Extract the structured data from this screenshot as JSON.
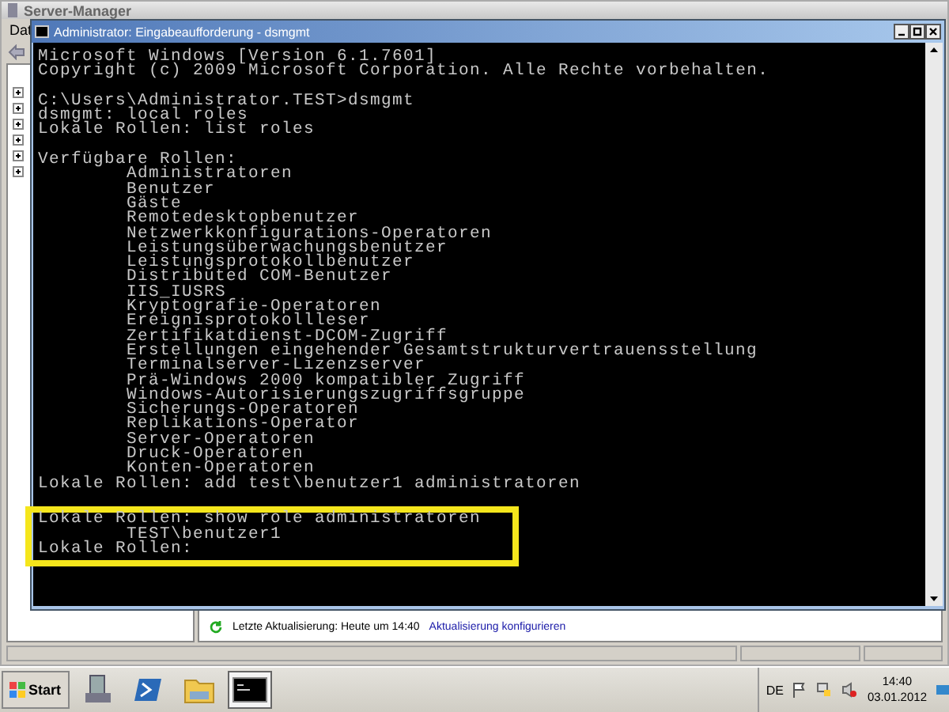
{
  "server_manager": {
    "title": "Server-Manager",
    "menu": [
      "Dat"
    ],
    "status": {
      "text": "Letzte Aktualisierung: Heute um 14:40",
      "link": "Aktualisierung konfigurieren"
    }
  },
  "console": {
    "title": "Administrator: Eingabeaufforderung - dsmgmt",
    "sections": [
      {
        "highlighted": false,
        "lines": [
          {
            "kind": "text",
            "indented": false,
            "text": "Microsoft Windows [Version 6.1.7601]"
          },
          {
            "kind": "text",
            "indented": false,
            "text": "Copyright (c) 2009 Microsoft Corporation. Alle Rechte vorbehalten."
          },
          {
            "kind": "blank"
          },
          {
            "kind": "text",
            "indented": false,
            "text": "C:\\Users\\Administrator.TEST>dsmgmt"
          },
          {
            "kind": "text",
            "indented": false,
            "text": "dsmgmt: local roles"
          },
          {
            "kind": "text",
            "indented": false,
            "text": "Lokale Rollen: list roles"
          },
          {
            "kind": "blank"
          },
          {
            "kind": "text",
            "indented": false,
            "text": "Verfügbare Rollen:"
          },
          {
            "kind": "text",
            "indented": true,
            "text": "Administratoren"
          },
          {
            "kind": "text",
            "indented": true,
            "text": "Benutzer"
          },
          {
            "kind": "text",
            "indented": true,
            "text": "Gäste"
          },
          {
            "kind": "text",
            "indented": true,
            "text": "Remotedesktopbenutzer"
          },
          {
            "kind": "text",
            "indented": true,
            "text": "Netzwerkkonfigurations-Operatoren"
          },
          {
            "kind": "text",
            "indented": true,
            "text": "Leistungsüberwachungsbenutzer"
          },
          {
            "kind": "text",
            "indented": true,
            "text": "Leistungsprotokollbenutzer"
          },
          {
            "kind": "text",
            "indented": true,
            "text": "Distributed COM-Benutzer"
          },
          {
            "kind": "text",
            "indented": true,
            "text": "IIS_IUSRS"
          },
          {
            "kind": "text",
            "indented": true,
            "text": "Kryptografie-Operatoren"
          },
          {
            "kind": "text",
            "indented": true,
            "text": "Ereignisprotokollleser"
          },
          {
            "kind": "text",
            "indented": true,
            "text": "Zertifikatdienst-DCOM-Zugriff"
          },
          {
            "kind": "text",
            "indented": true,
            "text": "Erstellungen eingehender Gesamtstrukturvertrauensstellung"
          },
          {
            "kind": "text",
            "indented": true,
            "text": "Terminalserver-Lizenzserver"
          },
          {
            "kind": "text",
            "indented": true,
            "text": "Prä-Windows 2000 kompatibler Zugriff"
          },
          {
            "kind": "text",
            "indented": true,
            "text": "Windows-Autorisierungszugriffsgruppe"
          },
          {
            "kind": "text",
            "indented": true,
            "text": "Sicherungs-Operatoren"
          },
          {
            "kind": "text",
            "indented": true,
            "text": "Replikations-Operator"
          },
          {
            "kind": "text",
            "indented": true,
            "text": "Server-Operatoren"
          },
          {
            "kind": "text",
            "indented": true,
            "text": "Druck-Operatoren"
          },
          {
            "kind": "text",
            "indented": true,
            "text": "Konten-Operatoren"
          },
          {
            "kind": "text",
            "indented": false,
            "text": "Lokale Rollen: add test\\benutzer1 administratoren"
          },
          {
            "kind": "covered"
          }
        ]
      },
      {
        "highlighted": true,
        "lines": [
          {
            "kind": "text",
            "indented": false,
            "text": "Lokale Rollen: show role administratoren"
          },
          {
            "kind": "text",
            "indented": true,
            "text": "TEST\\benutzer1"
          },
          {
            "kind": "text",
            "indented": false,
            "text": "Lokale Rollen:"
          }
        ]
      }
    ]
  },
  "taskbar": {
    "start": "Start",
    "apps": [
      {
        "kind": "server",
        "selected": false
      },
      {
        "kind": "powershell",
        "selected": false
      },
      {
        "kind": "folder",
        "selected": false
      },
      {
        "kind": "console",
        "selected": true
      }
    ],
    "language": "DE",
    "time": "14:40",
    "date": "03.01.2012"
  }
}
